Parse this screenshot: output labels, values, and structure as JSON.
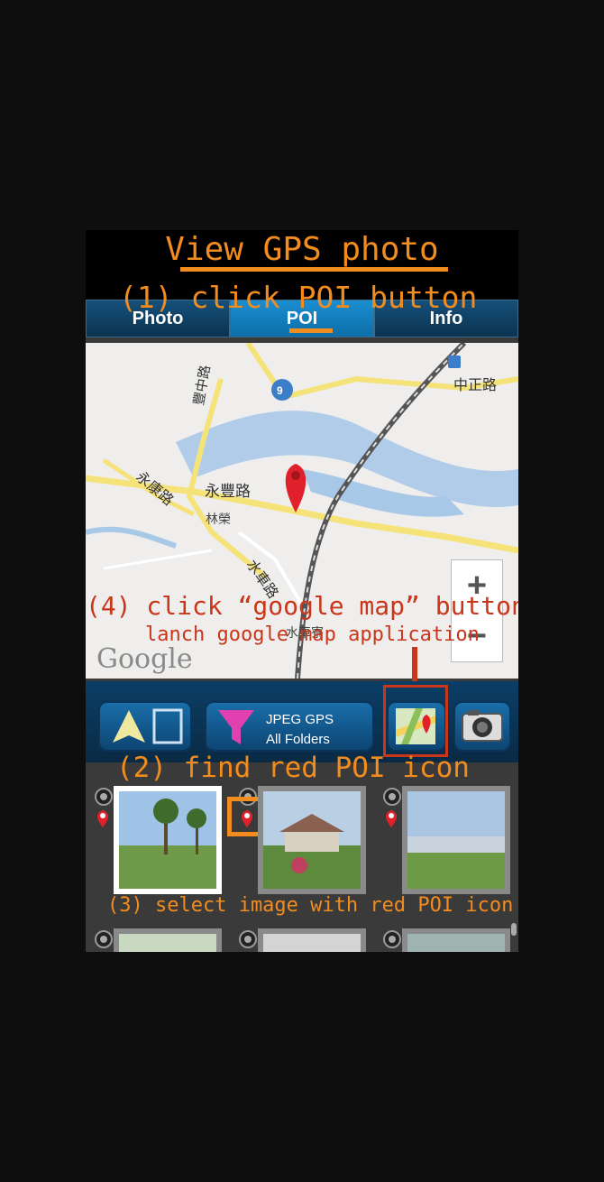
{
  "title": "View GPS photo",
  "annotations": {
    "step1": "(1) click POI button",
    "step2": "(2) find red POI icon",
    "step3": "(3) select image with red POI icon",
    "step4": "(4) click “google map” button",
    "step4_sub": "lanch google map application"
  },
  "tabs": [
    {
      "label": "Photo",
      "active": false
    },
    {
      "label": "POI",
      "active": true
    },
    {
      "label": "Info",
      "active": false
    }
  ],
  "map": {
    "labels": {
      "road_zhongzheng": "中正路",
      "route_number": "9",
      "road_yongkang": "永康路",
      "road_yongfeng": "永豐路",
      "place_linrong": "林榮",
      "road_shuiche": "水車路",
      "place_shuichelian": "水車寮",
      "road_vertical": "豐中路"
    },
    "attribution": "Google",
    "zoom_in": "+",
    "zoom_out": "−"
  },
  "toolbar": {
    "filter_line1": "JPEG   GPS",
    "filter_line2": "All Folders"
  },
  "colors": {
    "annotation_orange": "#f28c1e",
    "annotation_red": "#c9361b",
    "tab_active": "#1b8ed0",
    "poi_red": "#e0202a"
  }
}
